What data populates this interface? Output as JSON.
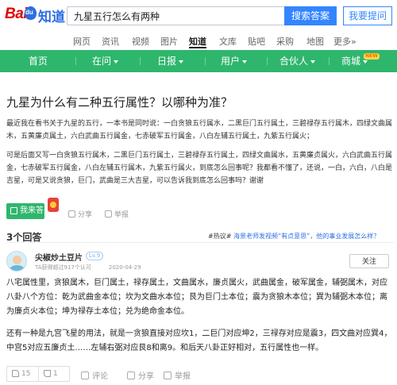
{
  "header": {
    "logo_bai": "Bai",
    "logo_product": "知道",
    "search_value": "九星五行怎么有两种",
    "search_button": "搜索答案",
    "ask_button": "我要提问"
  },
  "channels": [
    "网页",
    "资讯",
    "视频",
    "图片",
    "知道",
    "文库",
    "贴吧",
    "采购",
    "地图",
    "更多»"
  ],
  "active_channel": "知道",
  "nav": {
    "items": [
      "首页",
      "在问",
      "日报",
      "用户",
      "合伙人",
      "商城"
    ],
    "new_badge": "NEW"
  },
  "question": {
    "title": "九星为什么有二种五行属性？以哪种为准？",
    "para1": "最近我在看书关于九星的五行，一本书是同时说：一白贪狼五行属水，二黑巨门五行属土，三碧禄存五行属木，四绿文曲属木，五黄廉贞属土，六白武曲五行属金，七赤破军五行属金，八白左辅五行属土，九紫五行属火；",
    "para2": "可是后面又写一白贪狼五行属木，二黑巨门五行属土，三碧禄存五行属土，四绿文曲属水，五黄廉贞属火，六白武曲五行属金，七赤破军五行属金，八白左辅五行属木，九紫五行属火，到底怎么回事呢？我都看不懂了，还说，一白，六白，八白是吉星，可是又说贪狼，巨门，武曲是三大吉星，可以告诉我到底怎么回事吗？谢谢",
    "answer_button": "我来答",
    "share": "分享",
    "report": "举报"
  },
  "answers": {
    "count_label": "3个回答",
    "hot_tag": "#热议#",
    "hot_link": "海景老师发视频“有点意思”，他的事业发展怎么样？"
  },
  "answer": {
    "username": "尖椒炒土豆片",
    "level": "Lv.9",
    "meta": "TA获得超过917个认可",
    "date": "2020-04-29",
    "follow": "关注",
    "para1": "八宅属性里，贪狼属木，巨门属土，禄存属土，文曲属水，廉贞属火，武曲属金，破军属金，辅弼属木，对应八卦八个方位：乾为武曲金本位；坎为文曲水本位；艮为巨门土本位；震为贪狼木本位；巽为辅弼木本位；离为廉贞火本位；坤为禄存土本位；兑为绝命金本位。",
    "para2": "还有一种是九宫飞星的用法，就是一贪狼直接对应坎1，二巨门对应坤2，三禄存对应是震3，四文曲对应巽4，中宫5对应五廉贞土……左辅右弼对应艮8和离9。和后天八卦正好相对，五行属性也一样。",
    "likes": "15",
    "dislikes": "1",
    "comment": "评论",
    "share": "分享",
    "report": "举报"
  },
  "colors": {
    "nav_green": "#2fb66d",
    "search_blue": "#3385ff",
    "logo_red": "#e10601"
  }
}
